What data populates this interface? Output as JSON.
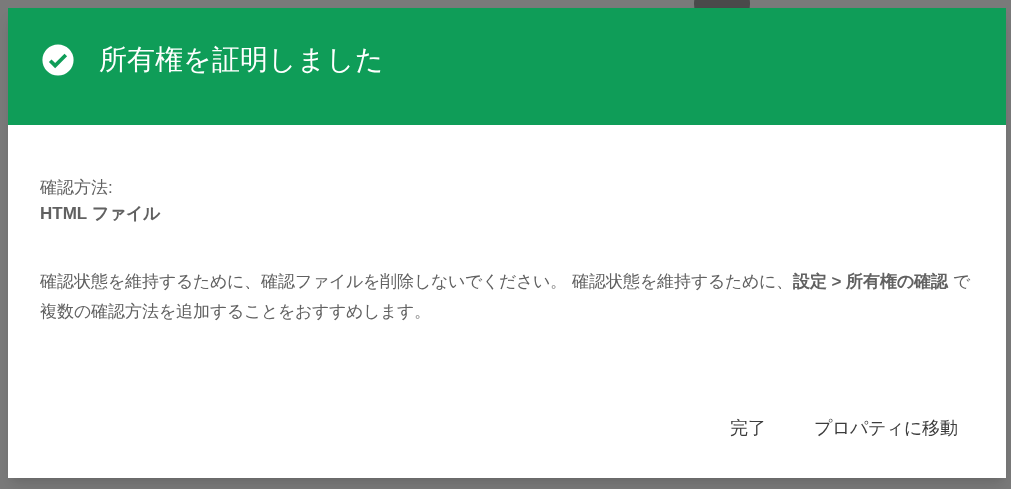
{
  "dialog": {
    "title": "所有権を証明しました",
    "method_label": "確認方法:",
    "method_value": "HTML ファイル",
    "message": "確認状態を維持するために、確認ファイルを削除しないでください。 確認状態を維持するために、**設定 > 所有権の確認** で複数の確認方法を追加することをおすすめします。",
    "buttons": [
      "完了",
      "プロパティに移動"
    ]
  }
}
